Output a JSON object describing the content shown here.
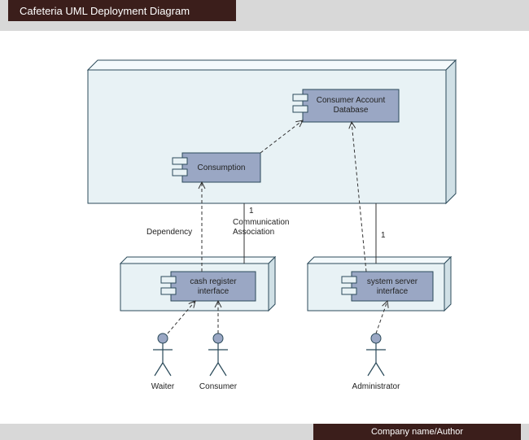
{
  "header": {
    "title": "Cafeteria UML Deployment Diagram"
  },
  "footer": {
    "author": "Company name/Author"
  },
  "nodes": {
    "big": {
      "label": ""
    },
    "cash": {
      "label": ""
    },
    "server": {
      "label": ""
    }
  },
  "components": {
    "database": {
      "label_line1": "Consumer Account",
      "label_line2": "Database"
    },
    "consumption": {
      "label": "Consumption"
    },
    "cash_register": {
      "label_line1": "cash register",
      "label_line2": "interface"
    },
    "system_server": {
      "label_line1": "system server",
      "label_line2": "interface"
    }
  },
  "relations": {
    "dependency": {
      "label": "Dependency"
    },
    "communication": {
      "label_line1": "Communication",
      "label_line2": "Association",
      "mult": "1"
    },
    "server_assoc": {
      "mult": "1"
    }
  },
  "actors": {
    "waiter": {
      "label": "Waiter"
    },
    "consumer": {
      "label": "Consumer"
    },
    "administrator": {
      "label": "Administrator"
    }
  }
}
